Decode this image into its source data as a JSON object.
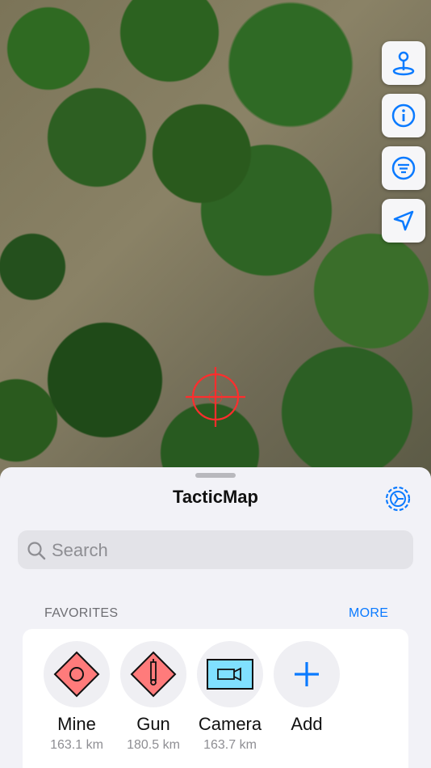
{
  "map": {
    "crosshair_color": "#ff2d2d",
    "buttons": [
      {
        "icon": "map-pin-icon"
      },
      {
        "icon": "info-icon"
      },
      {
        "icon": "list-icon"
      },
      {
        "icon": "location-arrow-icon"
      }
    ]
  },
  "sheet": {
    "title": "TacticMap",
    "settings_icon": "gear-icon",
    "search_placeholder": "Search",
    "favorites_label": "FAVORITES",
    "more_label": "MORE",
    "favorites": [
      {
        "name": "Mine",
        "distance": "163.1 km",
        "icon": "mine-icon"
      },
      {
        "name": "Gun",
        "distance": "180.5 km",
        "icon": "gun-icon"
      },
      {
        "name": "Camera",
        "distance": "163.7 km",
        "icon": "camera-icon"
      },
      {
        "name": "Add",
        "distance": "",
        "icon": "plus-icon"
      }
    ]
  },
  "colors": {
    "accent": "#0a7aff",
    "hostile": "#ff7b7b",
    "friendly": "#80e0ff"
  }
}
